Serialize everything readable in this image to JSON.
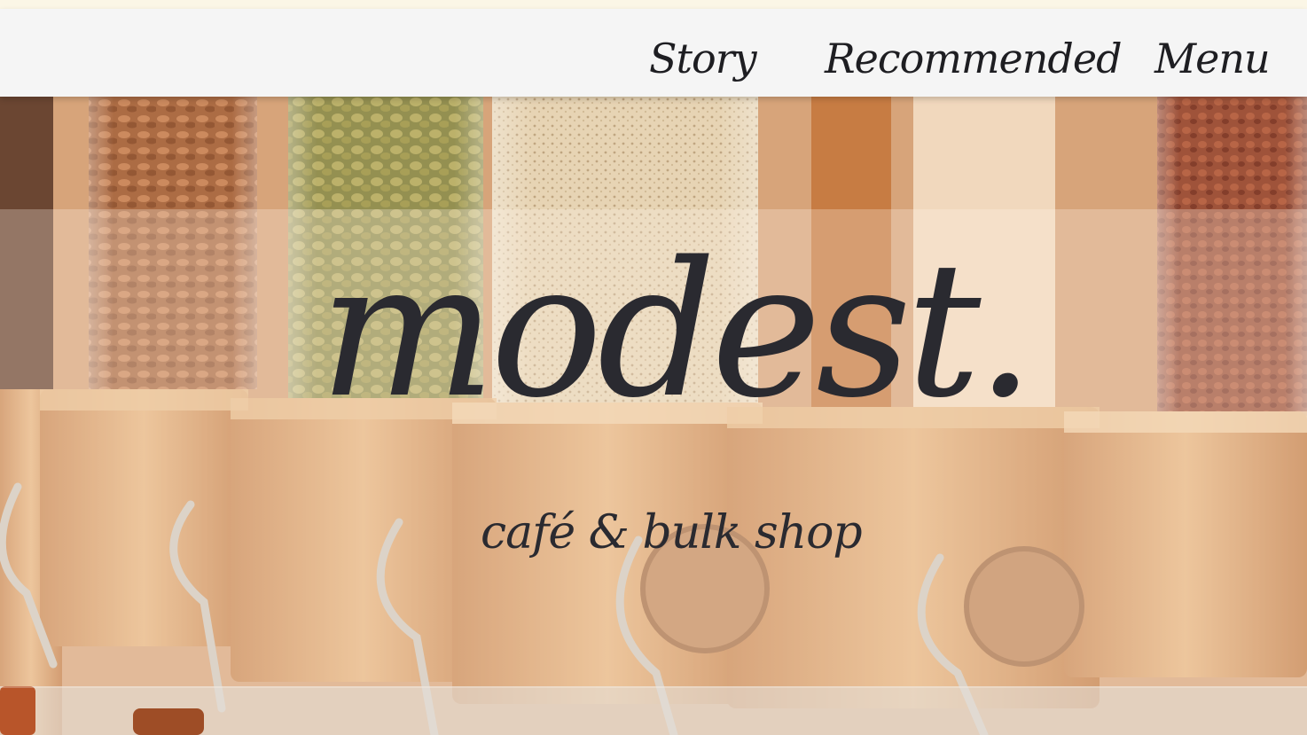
{
  "nav": {
    "items": [
      {
        "label": "Story"
      },
      {
        "label": "Recommended"
      },
      {
        "label": "Menu"
      }
    ]
  },
  "hero": {
    "logo_text": "modest.",
    "tagline": "café & bulk shop",
    "colors": {
      "text": "#2a2a30",
      "nav_background": "#f5f5f5",
      "top_strip": "#fbf6e6"
    }
  }
}
